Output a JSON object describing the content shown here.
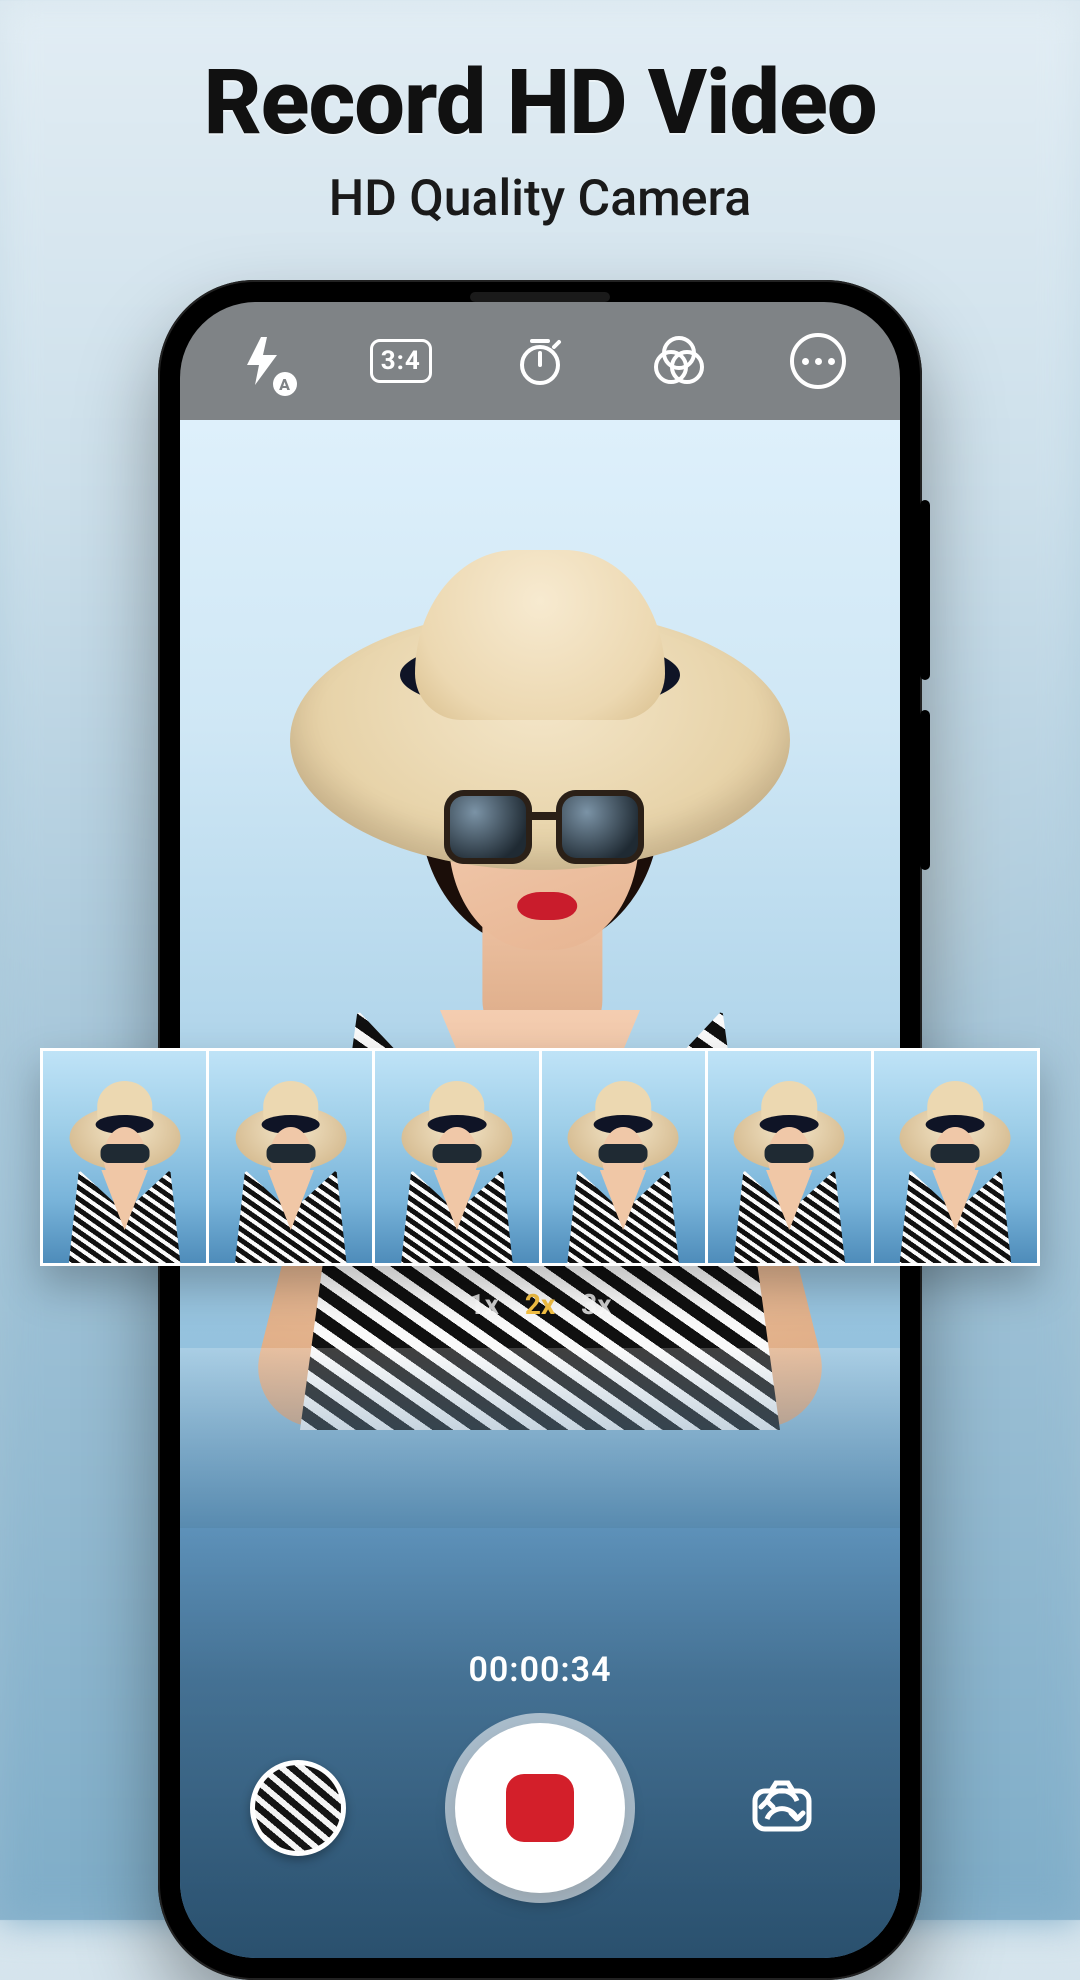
{
  "promo": {
    "title": "Record  HD Video",
    "subtitle": "HD Quality Camera"
  },
  "toolbar": {
    "flash_mode": "A",
    "aspect_ratio": "3:4",
    "icons": {
      "flash": "flash-auto-icon",
      "aspect": "aspect-ratio-icon",
      "timer": "timer-icon",
      "filter": "filter-icon",
      "more": "more-icon"
    }
  },
  "zoom": {
    "options": [
      "1x",
      "2x",
      "3x"
    ],
    "active": "2x"
  },
  "recording": {
    "timecode": "00:00:34"
  },
  "controls": {
    "gallery_thumb": "last-shot-thumbnail",
    "shutter": "record-stop-button",
    "flip": "switch-camera-icon"
  },
  "filmstrip": {
    "count": 6
  }
}
